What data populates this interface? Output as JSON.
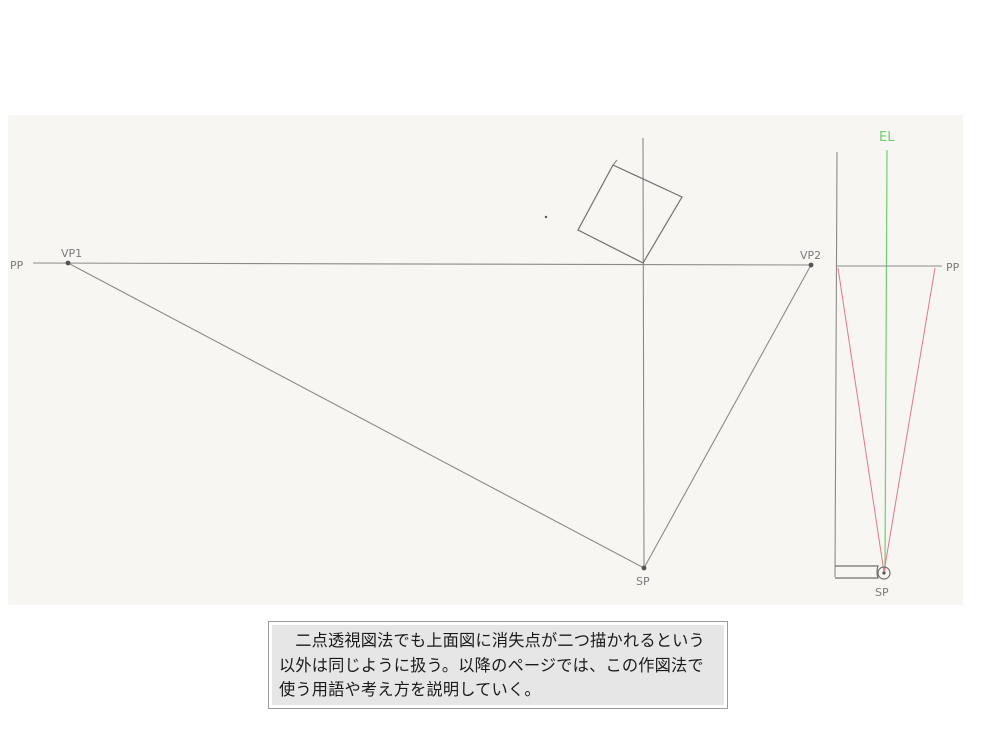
{
  "labels": {
    "pp_left": "PP",
    "vp1": "VP1",
    "vp2": "VP2",
    "sp_main": "SP",
    "el": "EL",
    "pp_right": "PP",
    "sp_side": "SP"
  },
  "colors": {
    "pencil": "#8a8a8a",
    "construction_red": "#e07a8a",
    "eye_level_green": "#6ecf6e",
    "caption_background": "#e6e6e6"
  },
  "caption": {
    "text": "二点透視図法でも上面図に消失点が二つ描かれるという以外は同じように扱う。以降のページでは、この作図法で使う用語や考え方を説明していく。"
  }
}
